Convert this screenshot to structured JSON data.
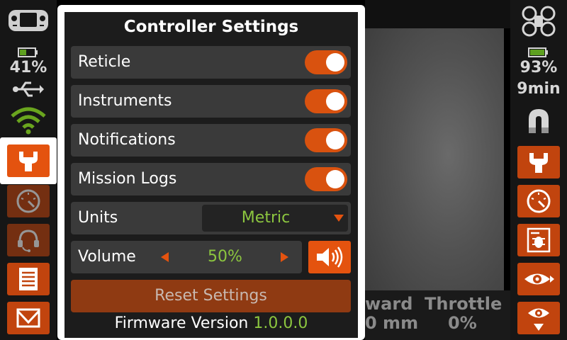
{
  "left_sidebar": {
    "battery_percent": "41%",
    "icons": [
      "gamepad-icon",
      "battery-icon",
      "usb-icon",
      "wifi-icon"
    ],
    "tools": [
      "wrench-icon",
      "gauge-icon",
      "headset-icon",
      "document-icon",
      "envelope-icon"
    ],
    "selected_tool": "wrench-icon"
  },
  "right_sidebar": {
    "battery_percent": "93%",
    "flight_time": "9min",
    "icons": [
      "drone-icon",
      "battery-icon",
      "magnet-icon"
    ],
    "tools": [
      "wrench-icon",
      "gauge-icon",
      "bug-icon",
      "eye-icon",
      "eye-down-icon"
    ]
  },
  "telemetry": {
    "forward_label": "ward",
    "forward_value": "0 mm",
    "throttle_label": "Throttle",
    "throttle_value": "0%"
  },
  "panel": {
    "title": "Controller Settings",
    "toggles": [
      {
        "label": "Reticle",
        "on": true
      },
      {
        "label": "Instruments",
        "on": true
      },
      {
        "label": "Notifications",
        "on": true
      },
      {
        "label": "Mission Logs",
        "on": true
      }
    ],
    "units": {
      "label": "Units",
      "value": "Metric"
    },
    "volume": {
      "label": "Volume",
      "value": "50%"
    },
    "reset_label": "Reset Settings",
    "firmware_label": "Firmware Version",
    "firmware_version": "1.0.0.0"
  },
  "colors": {
    "accent": "#e4530f",
    "accent_dark": "#8f3a12",
    "green": "#8cc63f",
    "row_bg": "#3a3a3a"
  }
}
